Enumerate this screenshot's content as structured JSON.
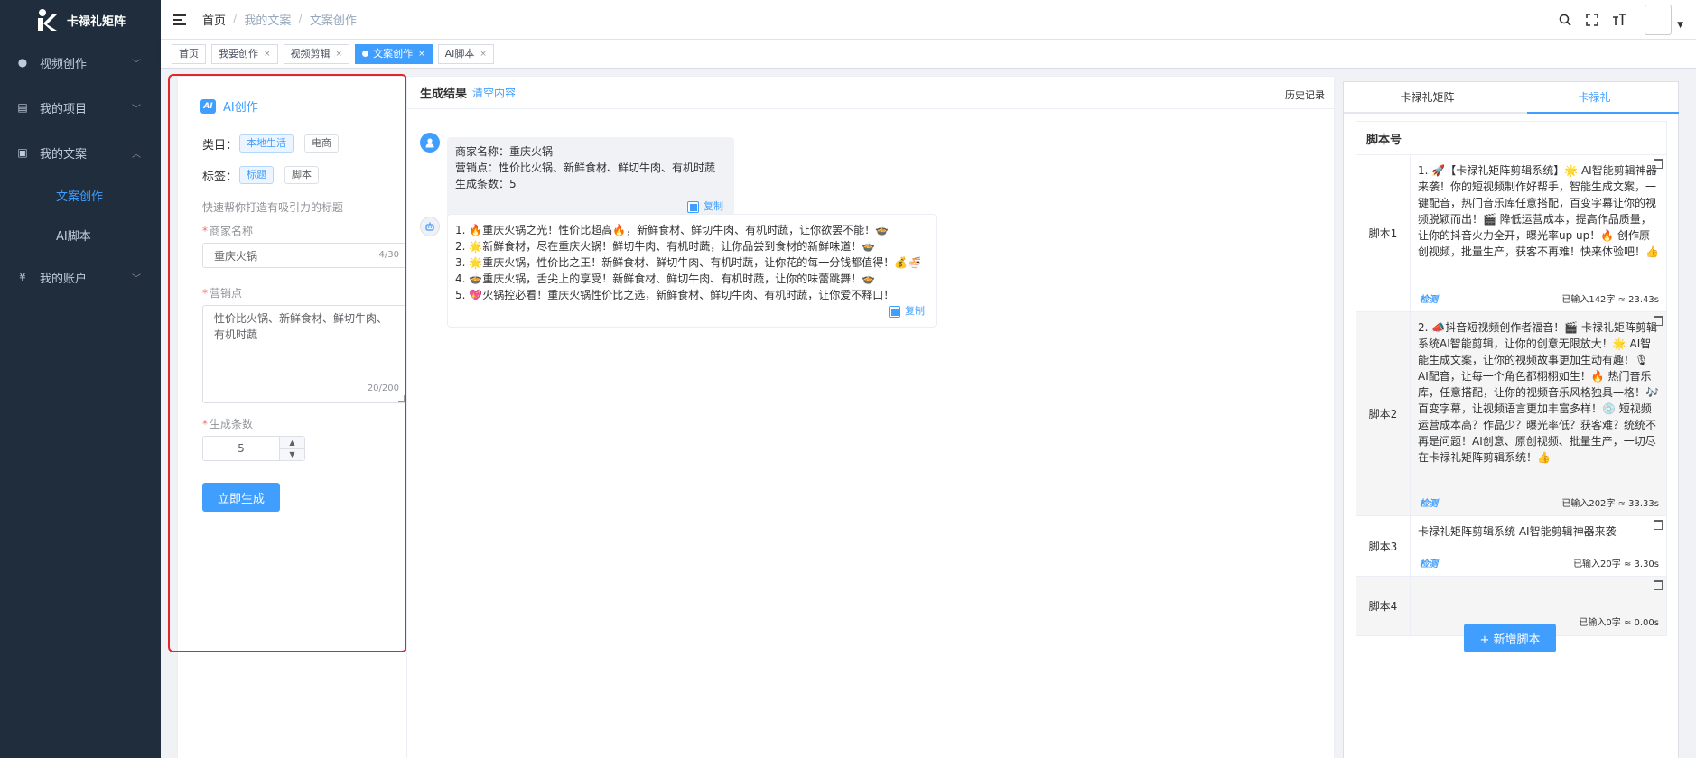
{
  "app": {
    "brand": "卡禄礼矩阵"
  },
  "sidebar": {
    "items": [
      {
        "label": "视频创作",
        "icon": "globe-icon"
      },
      {
        "label": "我的项目",
        "icon": "document-icon"
      },
      {
        "label": "我的文案",
        "icon": "image-icon"
      },
      {
        "label": "我的账户",
        "icon": "yen-icon"
      }
    ],
    "sub_items": [
      {
        "label": "文案创作",
        "active": true
      },
      {
        "label": "AI脚本",
        "active": false
      }
    ]
  },
  "breadcrumb": {
    "home": "首页",
    "level1": "我的文案",
    "level2": "文案创作",
    "sep": "/"
  },
  "tags": [
    "首页",
    "我要创作",
    "视频剪辑",
    "文案创作",
    "AI脚本"
  ],
  "form": {
    "title": "AI创作",
    "badge": "AI",
    "category_label": "类目：",
    "category_options": [
      "本地生活",
      "电商"
    ],
    "tag_label": "标签：",
    "tag_options": [
      "标题",
      "脚本"
    ],
    "hint": "快速帮你打造有吸引力的标题",
    "merchant_label": "商家名称",
    "merchant_value": "重庆火锅",
    "merchant_count": "4/30",
    "selling_label": "营销点",
    "selling_value": "性价比火锅、新鲜食材、鲜切牛肉、有机时蔬",
    "selling_count": "20/200",
    "count_label": "生成条数",
    "count_value": "5",
    "generate_button": "立即生成"
  },
  "result": {
    "title": "生成结果",
    "clear": "清空内容",
    "history": "历史记录",
    "copy": "复制",
    "query_lines": [
      "商家名称：重庆火锅",
      "营销点：性价比火锅、新鲜食材、鲜切牛肉、有机时蔬",
      "生成条数：5"
    ],
    "answer_lines": [
      "1. 🔥重庆火锅之光！性价比超高🔥，新鲜食材、鲜切牛肉、有机时蔬，让你欲罢不能！🍲",
      "2. 🌟新鲜食材，尽在重庆火锅！鲜切牛肉、有机时蔬，让你品尝到食材的新鲜味道！🍲",
      "3. 🌟重庆火锅，性价比之王！新鲜食材、鲜切牛肉、有机时蔬，让你花的每一分钱都值得！💰🍜",
      "4. 🍲重庆火锅，舌尖上的享受！新鲜食材、鲜切牛肉、有机时蔬，让你的味蕾跳舞！🍲",
      "5. 💖火锅控必看！重庆火锅性价比之选，新鲜食材、鲜切牛肉、有机时蔬，让你爱不释口！"
    ]
  },
  "scripts": {
    "tabs": [
      "卡禄礼矩阵",
      "卡禄礼"
    ],
    "header": "脚本号",
    "check": "检测",
    "add_button": "+ 新增脚本",
    "rows": [
      {
        "label": "脚本1",
        "text": "1. 🚀【卡禄礼矩阵剪辑系统】🌟 AI智能剪辑神器来袭！你的短视频制作好帮手，智能生成文案，一键配音，热门音乐库任意搭配，百变字幕让你的视频脱颖而出！🎬 降低运营成本，提高作品质量，让你的抖音火力全开，曝光率up up！🔥 创作原创视频，批量生产，获客不再难！快来体验吧！👍",
        "stat": "已输入142字 ≈ 23.43s"
      },
      {
        "label": "脚本2",
        "text": "2. 📣抖音短视频创作者福音！🎬 卡禄礼矩阵剪辑系统AI智能剪辑，让你的创意无限放大！🌟 AI智能生成文案，让你的视频故事更加生动有趣！🎙 AI配音，让每一个角色都栩栩如生！🔥 热门音乐库，任意搭配，让你的视频音乐风格独具一格！🎶 百变字幕，让视频语言更加丰富多样！💿 短视频运营成本高？作品少？曝光率低？获客难？统统不再是问题！AI创意、原创视频、批量生产，一切尽在卡禄礼矩阵剪辑系统！👍",
        "stat": "已输入202字 ≈ 33.33s"
      },
      {
        "label": "脚本3",
        "text": "卡禄礼矩阵剪辑系统 AI智能剪辑神器来袭",
        "stat": "已输入20字 ≈ 3.30s"
      },
      {
        "label": "脚本4",
        "text": "",
        "stat": "已输入0字 ≈ 0.00s"
      }
    ]
  },
  "colors": {
    "accent": "#409eff",
    "sidebar": "#1f2d3d",
    "highlight": "#e3262b"
  }
}
